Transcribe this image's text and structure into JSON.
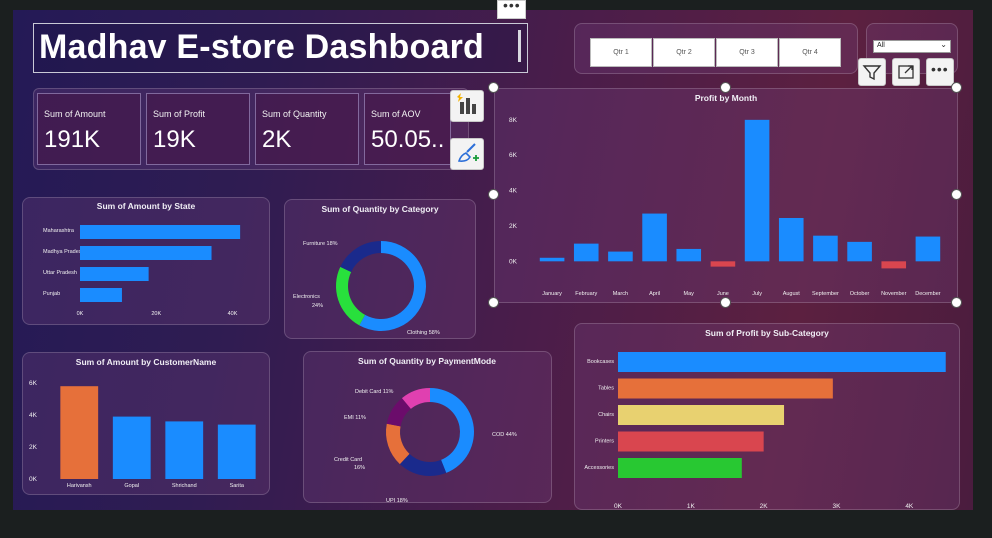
{
  "title": "Madhav E-store Dashboard",
  "kpis": [
    {
      "label": "Sum of Amount",
      "value": "191K"
    },
    {
      "label": "Sum of Profit",
      "value": "19K"
    },
    {
      "label": "Sum of Quantity",
      "value": "2K"
    },
    {
      "label": "Sum of AOV",
      "value": "50.05.."
    }
  ],
  "slicer": {
    "quarters": [
      "Qtr 1",
      "Qtr 2",
      "Qtr 3",
      "Qtr 4"
    ],
    "dropdown_value": "All"
  },
  "colors": {
    "blue": "#1a8cff",
    "orange": "#e6703a",
    "yellow": "#e8d170",
    "red": "#d9464f",
    "green": "#28c832"
  },
  "icons": [
    "filter-icon",
    "focus-mode-icon",
    "more-options-icon",
    "chart-type-icon",
    "format-brush-icon"
  ],
  "chart_data": [
    {
      "id": "profit_by_month",
      "type": "bar",
      "title": "Profit by Month",
      "categories": [
        "January",
        "February",
        "March",
        "April",
        "May",
        "June",
        "July",
        "August",
        "September",
        "October",
        "November",
        "December"
      ],
      "values": [
        200,
        1000,
        550,
        2700,
        700,
        -300,
        8000,
        2450,
        1450,
        1100,
        -400,
        1400
      ],
      "ylim": [
        -1000,
        8500
      ],
      "yticks": [
        0,
        2000,
        4000,
        6000,
        8000
      ],
      "ytick_labels": [
        "0K",
        "2K",
        "4K",
        "6K",
        "8K"
      ],
      "negative_color": "#d9464f"
    },
    {
      "id": "amount_by_state",
      "type": "bar",
      "orientation": "horizontal",
      "title": "Sum of Amount by State",
      "categories": [
        "Maharashtra",
        "Madhya Pradesh",
        "Uttar Pradesh",
        "Punjab"
      ],
      "values": [
        42000,
        34500,
        18000,
        11000
      ],
      "xlim": [
        0,
        48000
      ],
      "xticks": [
        0,
        20000,
        40000
      ],
      "xtick_labels": [
        "0K",
        "20K",
        "40K"
      ]
    },
    {
      "id": "quantity_by_category",
      "type": "pie",
      "donut": true,
      "title": "Sum of Quantity by Category",
      "slices": [
        {
          "label": "Clothing",
          "value": 58,
          "text": "Clothing 58%",
          "color": "#1a8cff"
        },
        {
          "label": "Electronics",
          "value": 24,
          "text": "Electronics 24%",
          "color": "#28e03c"
        },
        {
          "label": "Furniture",
          "value": 18,
          "text": "Furniture 18%",
          "color": "#1a2a8c"
        }
      ]
    },
    {
      "id": "amount_by_customer",
      "type": "bar",
      "title": "Sum of Amount by CustomerName",
      "categories": [
        "Harivansh",
        "Gopal",
        "Shrichand",
        "Sarita"
      ],
      "values": [
        5800,
        3900,
        3600,
        3400
      ],
      "colors": [
        "#e6703a",
        "#1a8cff",
        "#1a8cff",
        "#1a8cff"
      ],
      "ylim": [
        0,
        6000
      ],
      "yticks": [
        0,
        2000,
        4000,
        6000
      ],
      "ytick_labels": [
        "0K",
        "2K",
        "4K",
        "6K"
      ]
    },
    {
      "id": "quantity_by_paymentmode",
      "type": "pie",
      "donut": true,
      "title": "Sum of Quantity by PaymentMode",
      "slices": [
        {
          "label": "COD",
          "value": 44,
          "text": "COD 44%",
          "color": "#1a8cff"
        },
        {
          "label": "UPI",
          "value": 18,
          "text": "UPI 18%",
          "color": "#1a2a8c"
        },
        {
          "label": "Credit Card",
          "value": 16,
          "text_lines": [
            "Credit Card",
            "16%"
          ],
          "color": "#e6703a"
        },
        {
          "label": "EMI",
          "value": 11,
          "text": "EMI 11%",
          "color": "#6b0c6b"
        },
        {
          "label": "Debit Card",
          "value": 11,
          "text": "Debit Card 11%",
          "color": "#e040b0"
        }
      ]
    },
    {
      "id": "profit_by_subcategory",
      "type": "bar",
      "orientation": "horizontal",
      "title": "Sum of Profit by Sub-Category",
      "categories": [
        "Bookcases",
        "Tables",
        "Chairs",
        "Printers",
        "Accessories"
      ],
      "values": [
        4500,
        2950,
        2280,
        2000,
        1700
      ],
      "colors": [
        "#1a8cff",
        "#e6703a",
        "#e8d170",
        "#d9464f",
        "#28c832"
      ],
      "xlim": [
        0,
        4600
      ],
      "xticks": [
        0,
        1000,
        2000,
        3000,
        4000
      ],
      "xtick_labels": [
        "0K",
        "1K",
        "2K",
        "3K",
        "4K"
      ]
    }
  ]
}
